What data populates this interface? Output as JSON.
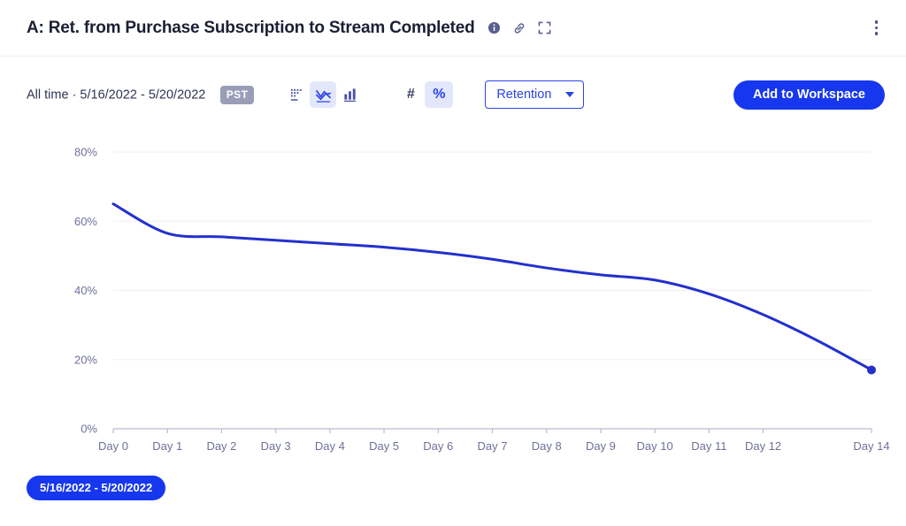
{
  "header": {
    "title": "A: Ret. from Purchase Subscription to Stream Completed",
    "info_icon": "info-icon",
    "link_icon": "link-icon",
    "expand_icon": "expand-icon",
    "menu_icon": "kebab-menu-icon"
  },
  "toolbar": {
    "range_text": "All time · 5/16/2022 - 5/20/2022",
    "timezone_badge": "PST",
    "chart_types": [
      {
        "name": "table-chart-icon",
        "label": "Table",
        "active": false
      },
      {
        "name": "line-chart-icon",
        "label": "Line",
        "active": true
      },
      {
        "name": "bar-chart-icon",
        "label": "Bar",
        "active": false
      }
    ],
    "number_format": [
      {
        "name": "absolute-number-toggle",
        "label": "#",
        "active": false
      },
      {
        "name": "percent-toggle",
        "label": "%",
        "active": true
      }
    ],
    "metric_dropdown": {
      "value": "Retention",
      "options": [
        "Retention"
      ]
    },
    "add_to_workspace_label": "Add to Workspace"
  },
  "legend": {
    "series_label": "5/16/2022 - 5/20/2022",
    "color": "#1637ed"
  },
  "colors": {
    "accent": "#1637ed",
    "line": "#2330cc",
    "axis_text": "#6e719b",
    "grid": "#f0f0f4",
    "badge_bg": "#9a9db8",
    "toggle_active_bg": "#e3e7fb"
  },
  "chart_data": {
    "type": "line",
    "title": "A: Ret. from Purchase Subscription to Stream Completed",
    "xlabel": "",
    "ylabel": "",
    "ylim": [
      0,
      90
    ],
    "y_ticks": [
      "0%",
      "20%",
      "40%",
      "60%",
      "80%"
    ],
    "y_tick_values": [
      0,
      20,
      40,
      60,
      80
    ],
    "grid": true,
    "legend_position": "bottom-left",
    "categories": [
      "Day 0",
      "Day 1",
      "Day 2",
      "Day 3",
      "Day 4",
      "Day 5",
      "Day 6",
      "Day 7",
      "Day 8",
      "Day 9",
      "Day 10",
      "Day 11",
      "Day 12",
      "",
      "Day 14"
    ],
    "x_tick_labels": [
      "Day 0",
      "Day 1",
      "Day 2",
      "Day 3",
      "Day 4",
      "Day 5",
      "Day 6",
      "Day 7",
      "Day 8",
      "Day 9",
      "Day 10",
      "Day 11",
      "Day 12",
      "",
      "Day 14"
    ],
    "series": [
      {
        "name": "5/16/2022 - 5/20/2022",
        "color": "#2330cc",
        "values": [
          65,
          56.5,
          55.5,
          54.5,
          53.5,
          52.5,
          51,
          49,
          46.5,
          44.5,
          43,
          39,
          33,
          25.5,
          17
        ],
        "end_marker": true
      }
    ]
  }
}
